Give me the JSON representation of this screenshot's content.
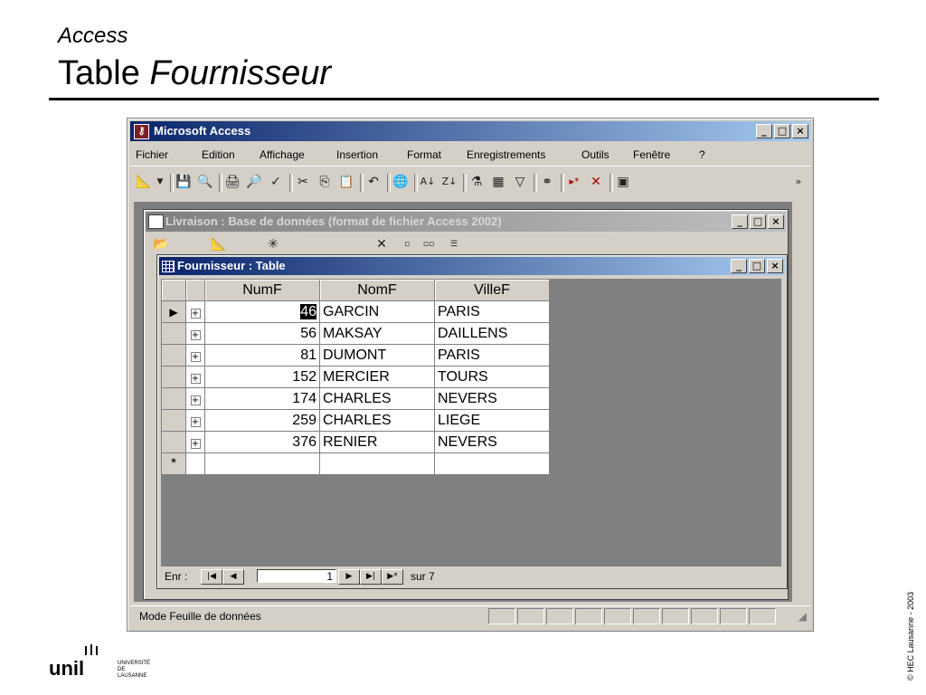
{
  "slide": {
    "subtitle": "Access",
    "title_plain": "Table",
    "title_italic": "Fournisseur",
    "copyright": "© HEC Lausanne - 2003"
  },
  "logo": {
    "mark": "unil",
    "line1": "UNIVERSITÉ",
    "line2": "DE",
    "line3": "LAUSANNE"
  },
  "app": {
    "title": "Microsoft Access",
    "window_buttons": [
      "_",
      "□",
      "×"
    ],
    "menu": [
      "Fichier",
      "Edition",
      "Affichage",
      "Insertion",
      "Format",
      "Enregistrements",
      "Outils",
      "Fenêtre",
      "?"
    ],
    "toolbar_icons": [
      "design-view-icon",
      "save-icon",
      "search-icon",
      "print-icon",
      "print-preview-icon",
      "spelling-icon",
      "cut-icon",
      "copy-icon",
      "paste-icon",
      "undo-icon",
      "hyperlink-icon",
      "sort-ascending-icon",
      "sort-descending-icon",
      "filter-by-selection-icon",
      "filter-by-form-icon",
      "apply-filter-icon",
      "find-icon",
      "new-record-icon",
      "delete-record-icon",
      "database-window-icon",
      "more-icon"
    ],
    "status": "Mode Feuille de données"
  },
  "db_window": {
    "title": "Livraison : Base de données (format de fichier Access 2002)"
  },
  "table_window": {
    "title": "Fournisseur : Table",
    "columns": [
      "NumF",
      "NomF",
      "VilleF"
    ],
    "rows": [
      {
        "num": "46",
        "nom": "GARCIN",
        "ville": "PARIS"
      },
      {
        "num": "56",
        "nom": "MAKSAY",
        "ville": "DAILLENS"
      },
      {
        "num": "81",
        "nom": "DUMONT",
        "ville": "PARIS"
      },
      {
        "num": "152",
        "nom": "MERCIER",
        "ville": "TOURS"
      },
      {
        "num": "174",
        "nom": "CHARLES",
        "ville": "NEVERS"
      },
      {
        "num": "259",
        "nom": "CHARLES",
        "ville": "LIEGE"
      },
      {
        "num": "376",
        "nom": "RENIER",
        "ville": "NEVERS"
      }
    ],
    "new_row_marker": "*",
    "current_row_marker": "▶",
    "expand_marker": "+",
    "nav": {
      "label": "Enr :",
      "current": "1",
      "total_label": "sur 7"
    }
  }
}
